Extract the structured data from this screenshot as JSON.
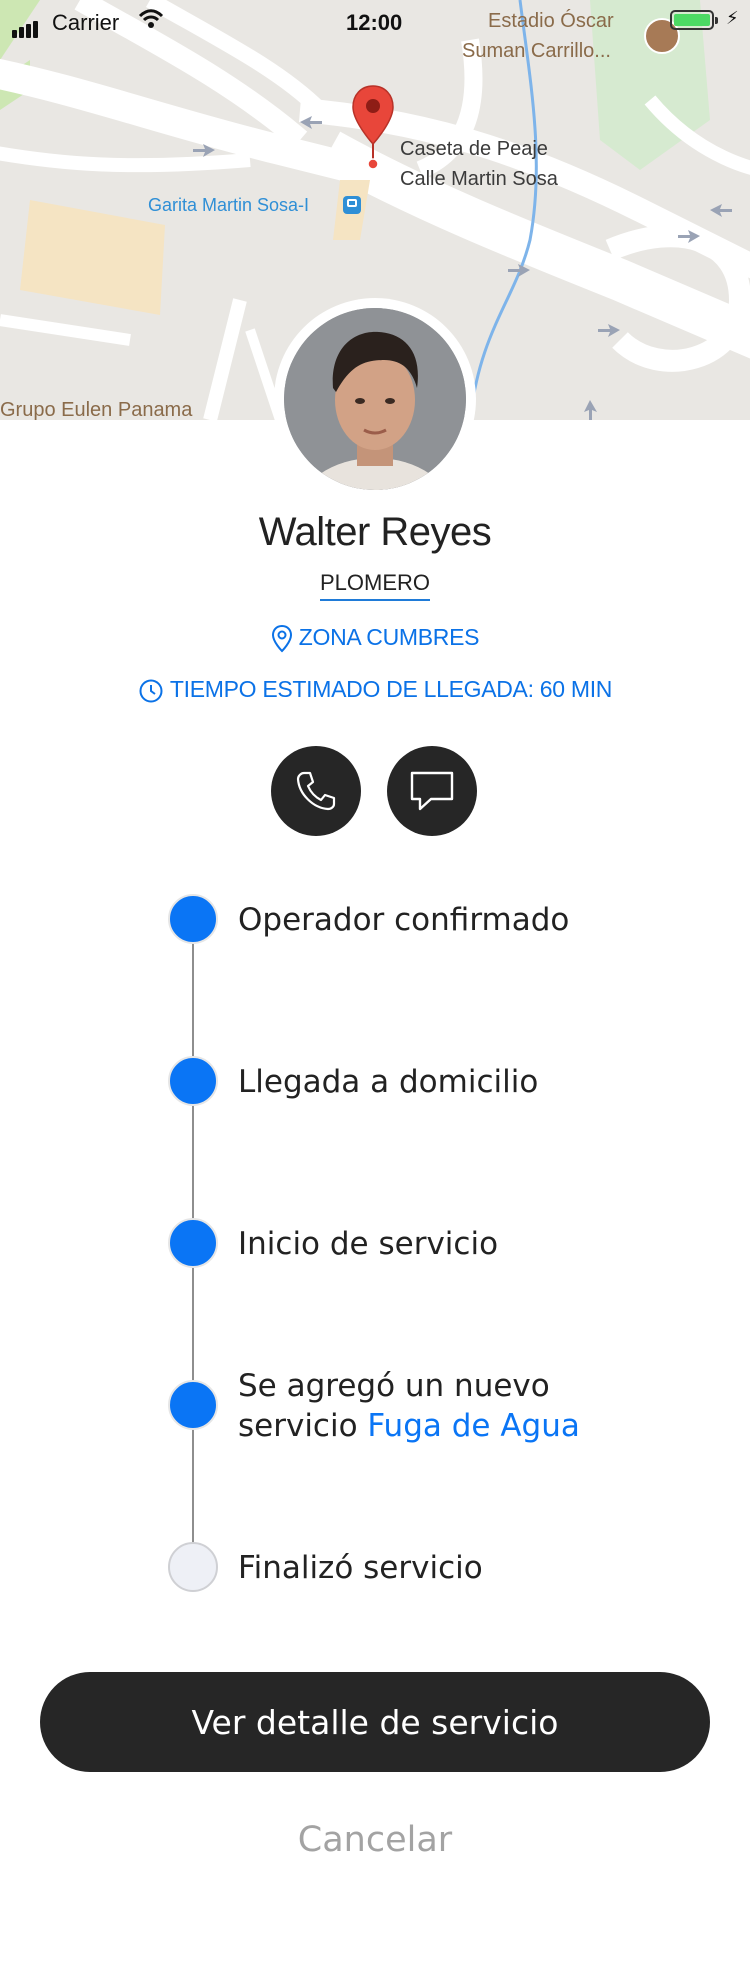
{
  "status_bar": {
    "carrier": "Carrier",
    "time": "12:00",
    "battery_color": "#4cd964"
  },
  "map": {
    "stadium_label_line1": "Estadio Óscar",
    "stadium_label_line2": "Suman Carrillo...",
    "poi_line1": "Caseta de Peaje",
    "poi_line2": "Calle Martin Sosa",
    "bus_stop": "Garita Martin Sosa-I",
    "company": "Grupo Eulen Panama",
    "pin_color": "#e8463a"
  },
  "profile": {
    "name": "Walter Reyes",
    "role": "PLOMERO",
    "zone": "ZONA CUMBRES",
    "eta": "TIEMPO ESTIMADO DE LLEGADA: 60 MIN",
    "accent_color": "#0b72e7"
  },
  "actions": {
    "call_icon": "phone-icon",
    "message_icon": "chat-bubble-icon"
  },
  "timeline": {
    "steps": [
      {
        "label": "Operador confirmado",
        "done": true
      },
      {
        "label": "Llegada a domicilio",
        "done": true
      },
      {
        "label": "Inicio de servicio",
        "done": true
      },
      {
        "label_line1": "Se agregó un nuevo",
        "label_line2": "servicio ",
        "link": "Fuga de Agua",
        "done": true
      },
      {
        "label": "Finalizó servicio",
        "done": false
      }
    ]
  },
  "buttons": {
    "detail": "Ver detalle de servicio",
    "cancel": "Cancelar"
  }
}
